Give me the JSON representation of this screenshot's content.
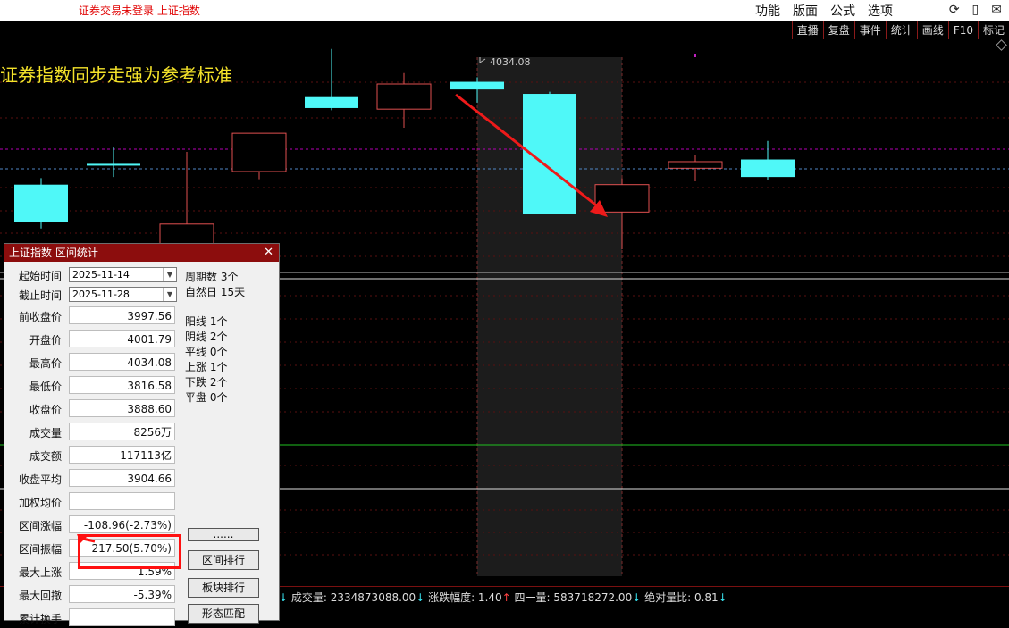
{
  "titlebar": {
    "status": "证券交易未登录  上证指数"
  },
  "menu": [
    "功能",
    "版面",
    "公式",
    "选项"
  ],
  "top_icons": [
    "refresh-icon",
    "phone-icon",
    "mail-icon"
  ],
  "toolbar": [
    "直播",
    "复盘",
    "事件",
    "统计",
    "画线",
    "F10",
    "标记"
  ],
  "banner": "证券指数同步走强为参考标准",
  "chart": {
    "high_label": "4034.08"
  },
  "chart_data": {
    "type": "candlestick",
    "candles": [
      {
        "open": 3936,
        "close": 3902,
        "high": 3942,
        "low": 3896,
        "dir": "down"
      },
      {
        "open": 3955,
        "close": 3954,
        "high": 3970,
        "low": 3943,
        "dir": "flat"
      },
      {
        "open": 3900,
        "close": 3877,
        "high": 3966,
        "low": 3860,
        "dir": "up"
      },
      {
        "open": 3948,
        "close": 3983,
        "high": 3983,
        "low": 3941,
        "dir": "up"
      },
      {
        "open": 4016,
        "close": 4006,
        "high": 4060,
        "low": 4004,
        "dir": "down"
      },
      {
        "open": 4028,
        "close": 4005,
        "high": 4038,
        "low": 3988,
        "dir": "up"
      },
      {
        "open": 4030,
        "close": 4023,
        "high": 4034.08,
        "low": 4011,
        "dir": "down"
      },
      {
        "open": 4019,
        "close": 3909,
        "high": 4021,
        "low": 3909,
        "dir": "down"
      },
      {
        "open": 3936,
        "close": 3911,
        "high": 3942,
        "low": 3877,
        "dir": "up"
      },
      {
        "open": 3957,
        "close": 3951,
        "high": 3963,
        "low": 3939,
        "dir": "up"
      },
      {
        "open": 3959,
        "close": 3943,
        "high": 3976,
        "low": 3940,
        "dir": "down"
      }
    ]
  },
  "panel": {
    "title": "上证指数 区间统计",
    "start_label": "起始时间",
    "start_date": "2025-11-14",
    "end_label": "截止时间",
    "end_date": "2025-11-28",
    "rows": [
      {
        "label": "前收盘价",
        "value": "3997.56"
      },
      {
        "label": "开盘价",
        "value": "4001.79"
      },
      {
        "label": "最高价",
        "value": "4034.08"
      },
      {
        "label": "最低价",
        "value": "3816.58"
      },
      {
        "label": "收盘价",
        "value": "3888.60"
      },
      {
        "label": "成交量",
        "value": "8256万"
      },
      {
        "label": "成交额",
        "value": "117113亿"
      },
      {
        "label": "收盘平均",
        "value": "3904.66"
      },
      {
        "label": "加权均价",
        "value": ""
      },
      {
        "label": "区间涨幅",
        "value": "-108.96(-2.73%)"
      },
      {
        "label": "区间振幅",
        "value": "217.50(5.70%)"
      },
      {
        "label": "最大上涨",
        "value": "1.59%"
      },
      {
        "label": "最大回撤",
        "value": "-5.39%"
      },
      {
        "label": "累计换手",
        "value": ""
      }
    ],
    "stats1": [
      "周期数 3个",
      "自然日 15天"
    ],
    "stats2": [
      "阳线 1个",
      "阴线 2个",
      "平线 0个",
      "上涨 1个",
      "下跌 2个",
      "平盘 0个"
    ],
    "buttons": [
      "......",
      "区间排行",
      "板块排行",
      "形态匹配"
    ]
  },
  "status": {
    "vol_label": "成交量: 2334873088.00",
    "chg_label": "涨跌幅度: 1.40",
    "q_label": "四一量: 583718272.00",
    "ratio_label": "绝对量比: 0.81"
  }
}
